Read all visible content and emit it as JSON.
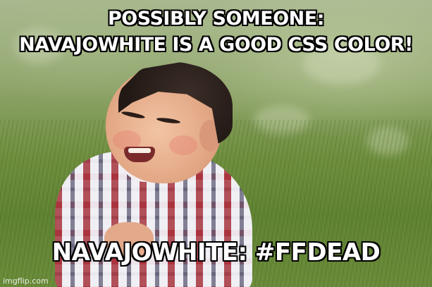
{
  "meme": {
    "top_line_1": "POSSIBLY SOMEONE:",
    "top_line_2": "NAVAJOWHITE IS A GOOD CSS COLOR!",
    "bottom_text": "NAVAJOWHITE: #FFDEAD",
    "watermark": "imgflip.com"
  },
  "colors": {
    "caption_text": "#ffffff",
    "caption_outline": "#000000"
  }
}
